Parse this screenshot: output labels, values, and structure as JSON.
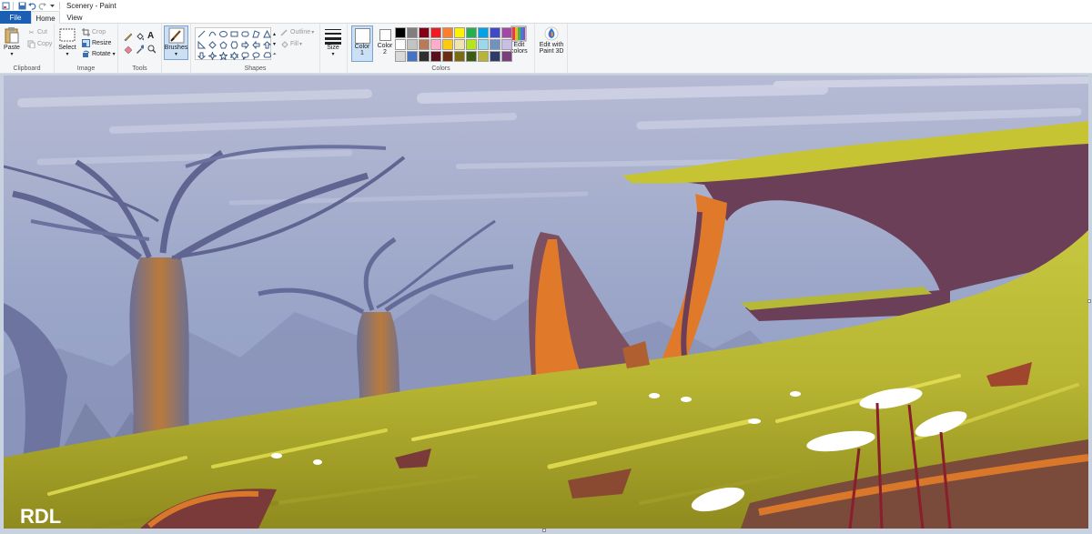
{
  "window": {
    "title": "Scenery - Paint"
  },
  "tabs": [
    {
      "label": "File"
    },
    {
      "label": "Home"
    },
    {
      "label": "View"
    }
  ],
  "ribbon": {
    "clipboard": {
      "label": "Clipboard",
      "paste": "Paste",
      "cut": "Cut",
      "copy": "Copy"
    },
    "image": {
      "label": "Image",
      "select": "Select",
      "crop": "Crop",
      "resize": "Resize",
      "rotate": "Rotate"
    },
    "tools": {
      "label": "Tools"
    },
    "brushes": {
      "label": "Brushes"
    },
    "shapes": {
      "label": "Shapes",
      "outline": "Outline",
      "fill": "Fill"
    },
    "size": {
      "label": "Size"
    },
    "colors": {
      "label": "Colors",
      "color1": "Color",
      "color1_num": "1",
      "color2": "Color",
      "color2_num": "2",
      "edit_colors_line1": "Edit",
      "edit_colors_line2": "colors",
      "edit_3d_line1": "Edit with",
      "edit_3d_line2": "Paint 3D",
      "palette": [
        "#000000",
        "#7f7f7f",
        "#880015",
        "#ed1c24",
        "#ff7f27",
        "#fff200",
        "#22b14c",
        "#00a2e8",
        "#3f48cc",
        "#a349a4",
        "#ffffff",
        "#c3c3c3",
        "#b97a57",
        "#ffaec9",
        "#ffc90e",
        "#efe4b0",
        "#b5e61d",
        "#99d9ea",
        "#7092be",
        "#c8bfe7",
        "#d9d9d9",
        "#4472c4",
        "#2f2f2f",
        "#5b0f1a",
        "#6b2d0f",
        "#7a6a10",
        "#3c5a12",
        "#b8b43a",
        "#2b3b6b",
        "#7a3f7a"
      ]
    }
  },
  "canvas": {
    "signature": "RDL"
  }
}
